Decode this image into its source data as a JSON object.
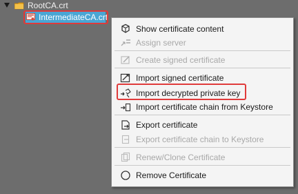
{
  "tree": {
    "root_label": "RootCA.crt",
    "child_label": "IntermediateCA.crt",
    "selection_color": "#4aa6d4"
  },
  "menu": {
    "items": [
      {
        "label": "Show certificate content",
        "icon": "certificate-content-icon",
        "enabled": true
      },
      {
        "label": "Assign server",
        "icon": "assign-server-icon",
        "enabled": false
      },
      {
        "label": "Create signed certificate",
        "icon": "create-signed-certificate-icon",
        "enabled": false
      },
      {
        "label": "Import signed certificate",
        "icon": "import-signed-certificate-icon",
        "enabled": true
      },
      {
        "label": "Import decrypted private key",
        "icon": "import-private-key-icon",
        "enabled": true
      },
      {
        "label": "Import certificate chain from Keystore",
        "icon": "import-chain-icon",
        "enabled": true
      },
      {
        "label": "Export certificate",
        "icon": "export-certificate-icon",
        "enabled": true
      },
      {
        "label": "Export certificate chain to Keystore",
        "icon": "export-chain-icon",
        "enabled": false
      },
      {
        "label": "Renew/Clone Certificate",
        "icon": "renew-clone-icon",
        "enabled": false
      },
      {
        "label": "Remove Certificate",
        "icon": "remove-certificate-icon",
        "enabled": true
      }
    ]
  },
  "highlight_color": "#e03a3a"
}
